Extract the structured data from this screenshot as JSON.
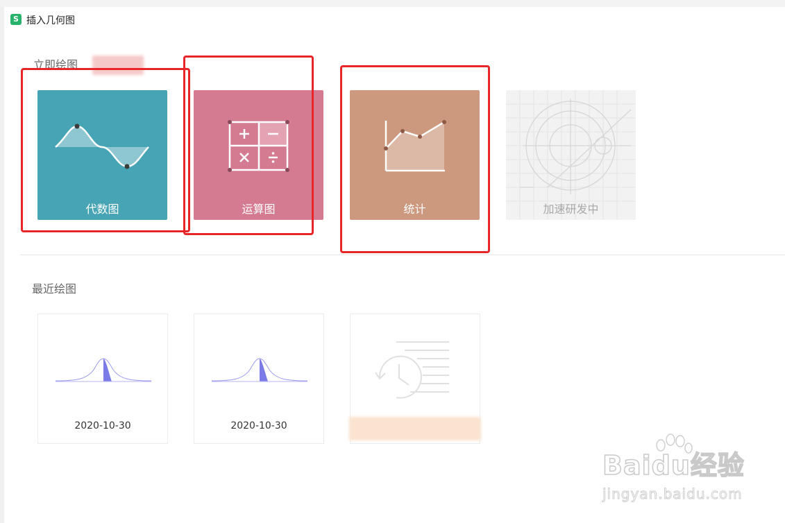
{
  "window": {
    "title": "插入几何图",
    "logo_letter": "S"
  },
  "sections": {
    "draw_now": "立即绘图",
    "recent": "最近绘图"
  },
  "cards": [
    {
      "label": "代数图",
      "color": "#47a4b5",
      "icon": "sine-wave-icon"
    },
    {
      "label": "运算图",
      "color": "#d47b92",
      "icon": "calculator-icon"
    },
    {
      "label": "统计",
      "color": "#cc987e",
      "icon": "area-chart-icon"
    },
    {
      "label": "加速研发中",
      "color": "#f2f2f2",
      "icon": "compass-sketch-icon"
    }
  ],
  "recent": [
    {
      "date": "2020-10-30",
      "thumbnail": "normal-distribution-icon"
    },
    {
      "date": "2020-10-30",
      "thumbnail": "normal-distribution-icon"
    },
    {
      "date": "",
      "thumbnail": "history-icon"
    }
  ],
  "watermark": {
    "text": "Baidu经验",
    "sub": "jingyan.baidu.com"
  },
  "colors": {
    "highlight": "#e8262a",
    "app_green": "#27b36b"
  }
}
